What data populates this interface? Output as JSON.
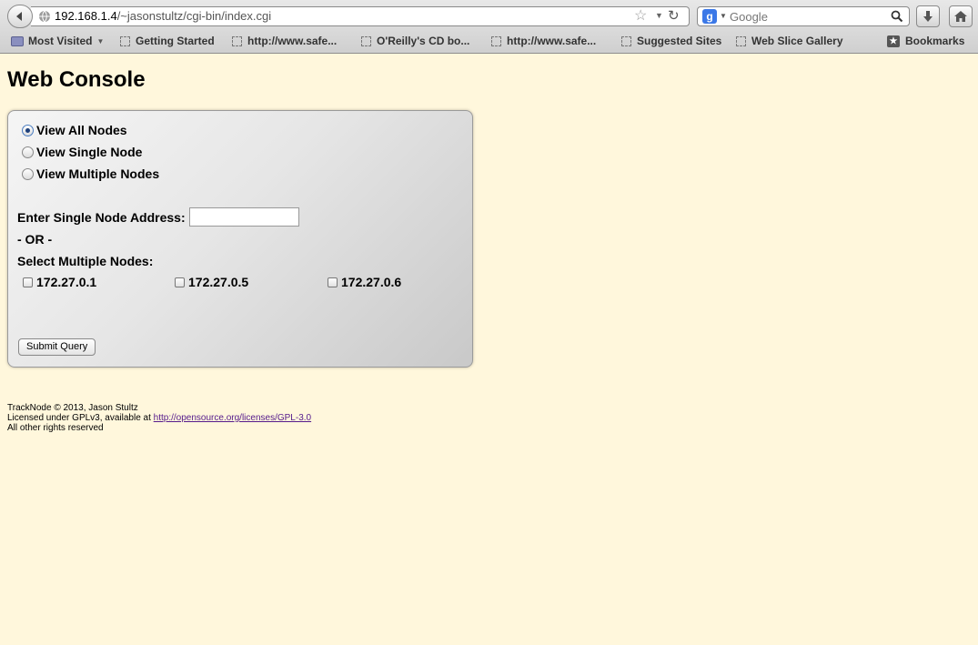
{
  "browser": {
    "url_host": "192.168.1.4",
    "url_path": "/~jasonstultz/cgi-bin/index.cgi",
    "search_engine": "Google",
    "bookmarks": [
      {
        "label": "Most Visited",
        "kind": "folder"
      },
      {
        "label": "Getting Started",
        "kind": "page"
      },
      {
        "label": "http://www.safe...",
        "kind": "page"
      },
      {
        "label": "O'Reilly's CD bo...",
        "kind": "page"
      },
      {
        "label": "http://www.safe...",
        "kind": "page"
      },
      {
        "label": "Suggested Sites",
        "kind": "page"
      },
      {
        "label": "Web Slice Gallery",
        "kind": "page"
      },
      {
        "label": "Bookmarks",
        "kind": "menu"
      }
    ]
  },
  "page": {
    "title": "Web Console",
    "view_options": [
      {
        "label": "View All Nodes",
        "checked": true
      },
      {
        "label": "View Single Node",
        "checked": false
      },
      {
        "label": "View Multiple Nodes",
        "checked": false
      }
    ],
    "single_node_label": "Enter Single Node Address:",
    "single_node_value": "",
    "or_label": "- OR -",
    "multi_label": "Select Multiple Nodes:",
    "nodes": [
      "172.27.0.1",
      "172.27.0.5",
      "172.27.0.6"
    ],
    "submit_label": "Submit Query"
  },
  "footer": {
    "line1": "TrackNode © 2013, Jason Stultz",
    "line2_prefix": "Licensed under GPLv3, available at ",
    "license_link": "http://opensource.org/licenses/GPL-3.0",
    "line3": "All other rights reserved"
  }
}
